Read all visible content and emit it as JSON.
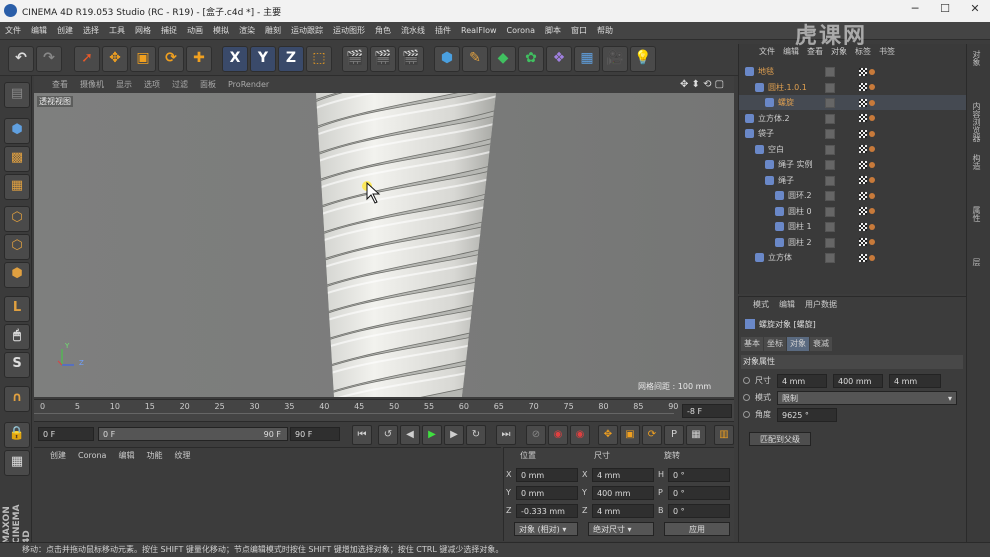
{
  "window": {
    "title": "CINEMA 4D R19.053 Studio (RC - R19) - [盒子.c4d *] - 主要",
    "min_icon": "minimize-icon",
    "max_icon": "maximize-icon",
    "close_icon": "close-icon"
  },
  "menu": [
    "文件",
    "编辑",
    "创建",
    "选择",
    "工具",
    "网格",
    "捕捉",
    "动画",
    "模拟",
    "渲染",
    "雕刻",
    "运动跟踪",
    "运动图形",
    "角色",
    "流水线",
    "插件",
    "RealFlow",
    "Corona",
    "脚本",
    "窗口",
    "帮助"
  ],
  "viewport": {
    "menu": [
      "查看",
      "摄像机",
      "显示",
      "选项",
      "过滤",
      "面板",
      "ProRender"
    ],
    "label": "透视视图",
    "grid_text": "网格间距 : 100 mm",
    "axis_y": "Y",
    "axis_z": "Z"
  },
  "timeline": {
    "ticks": [
      "0",
      "5",
      "10",
      "15",
      "20",
      "25",
      "30",
      "35",
      "40",
      "45",
      "50",
      "55",
      "60",
      "65",
      "70",
      "75",
      "80",
      "85",
      "90"
    ],
    "current": "-8 F"
  },
  "transport": {
    "start": "0 F",
    "slider_start": "0 F",
    "slider_end": "90 F",
    "end": "90 F"
  },
  "material_manager": {
    "menu": [
      "创建",
      "Corona",
      "编辑",
      "功能",
      "纹理"
    ]
  },
  "coordinates": {
    "headers": [
      "位置",
      "尺寸",
      "旋转"
    ],
    "rows": [
      {
        "a": "X",
        "av": "0 mm",
        "b": "X",
        "bv": "4 mm",
        "c": "H",
        "cv": "0 °"
      },
      {
        "a": "Y",
        "av": "0 mm",
        "b": "Y",
        "bv": "400 mm",
        "c": "P",
        "cv": "0 °"
      },
      {
        "a": "Z",
        "av": "-0.333 mm",
        "b": "Z",
        "bv": "4 mm",
        "c": "B",
        "cv": "0 °"
      }
    ],
    "mode": "对象 (相对)",
    "size_mode": "绝对尺寸",
    "apply": "应用"
  },
  "object_manager": {
    "menu": [
      "文件",
      "编辑",
      "查看",
      "对象",
      "标签",
      "书签"
    ],
    "items": [
      {
        "name": "地毯",
        "indent": 0,
        "color": "#e0a050"
      },
      {
        "name": "圆柱.1.0.1",
        "indent": 1,
        "color": "#e0a050"
      },
      {
        "name": "螺旋",
        "indent": 2,
        "color": "#e0a050"
      },
      {
        "name": "立方体.2",
        "indent": 0,
        "color": "#cfcfcf"
      },
      {
        "name": "袋子",
        "indent": 0,
        "color": "#cfcfcf"
      },
      {
        "name": "空白",
        "indent": 1,
        "color": "#cfcfcf"
      },
      {
        "name": "绳子 实例",
        "indent": 2,
        "color": "#cfcfcf"
      },
      {
        "name": "绳子",
        "indent": 2,
        "color": "#cfcfcf"
      },
      {
        "name": "圆环.2",
        "indent": 3,
        "color": "#cfcfcf"
      },
      {
        "name": "圆柱 0",
        "indent": 3,
        "color": "#cfcfcf"
      },
      {
        "name": "圆柱 1",
        "indent": 3,
        "color": "#cfcfcf"
      },
      {
        "name": "圆柱 2",
        "indent": 3,
        "color": "#cfcfcf"
      },
      {
        "name": "立方体",
        "indent": 1,
        "color": "#cfcfcf"
      }
    ]
  },
  "attributes": {
    "menu": [
      "模式",
      "编辑",
      "用户数据"
    ],
    "title": "螺旋对象 [螺旋]",
    "tabs": [
      "基本",
      "坐标",
      "对象",
      "衰减"
    ],
    "active_tab": "对象",
    "section": "对象属性",
    "size_label": "尺寸",
    "size_values": [
      "4 mm",
      "400 mm",
      "4 mm"
    ],
    "mode_label": "模式",
    "mode_value": "限制",
    "angle_label": "角度",
    "angle_value": "9625 °",
    "fit_button": "匹配到父级"
  },
  "right_tabs": [
    "对象",
    "内容浏览器",
    "构造",
    "属性",
    "层"
  ],
  "status": "移动：点击并拖动鼠标移动元素。按住 SHIFT 键量化移动；节点编辑模式时按住 SHIFT 键增加选择对象；按住 CTRL 键减少选择对象。",
  "watermark": "虎课网"
}
